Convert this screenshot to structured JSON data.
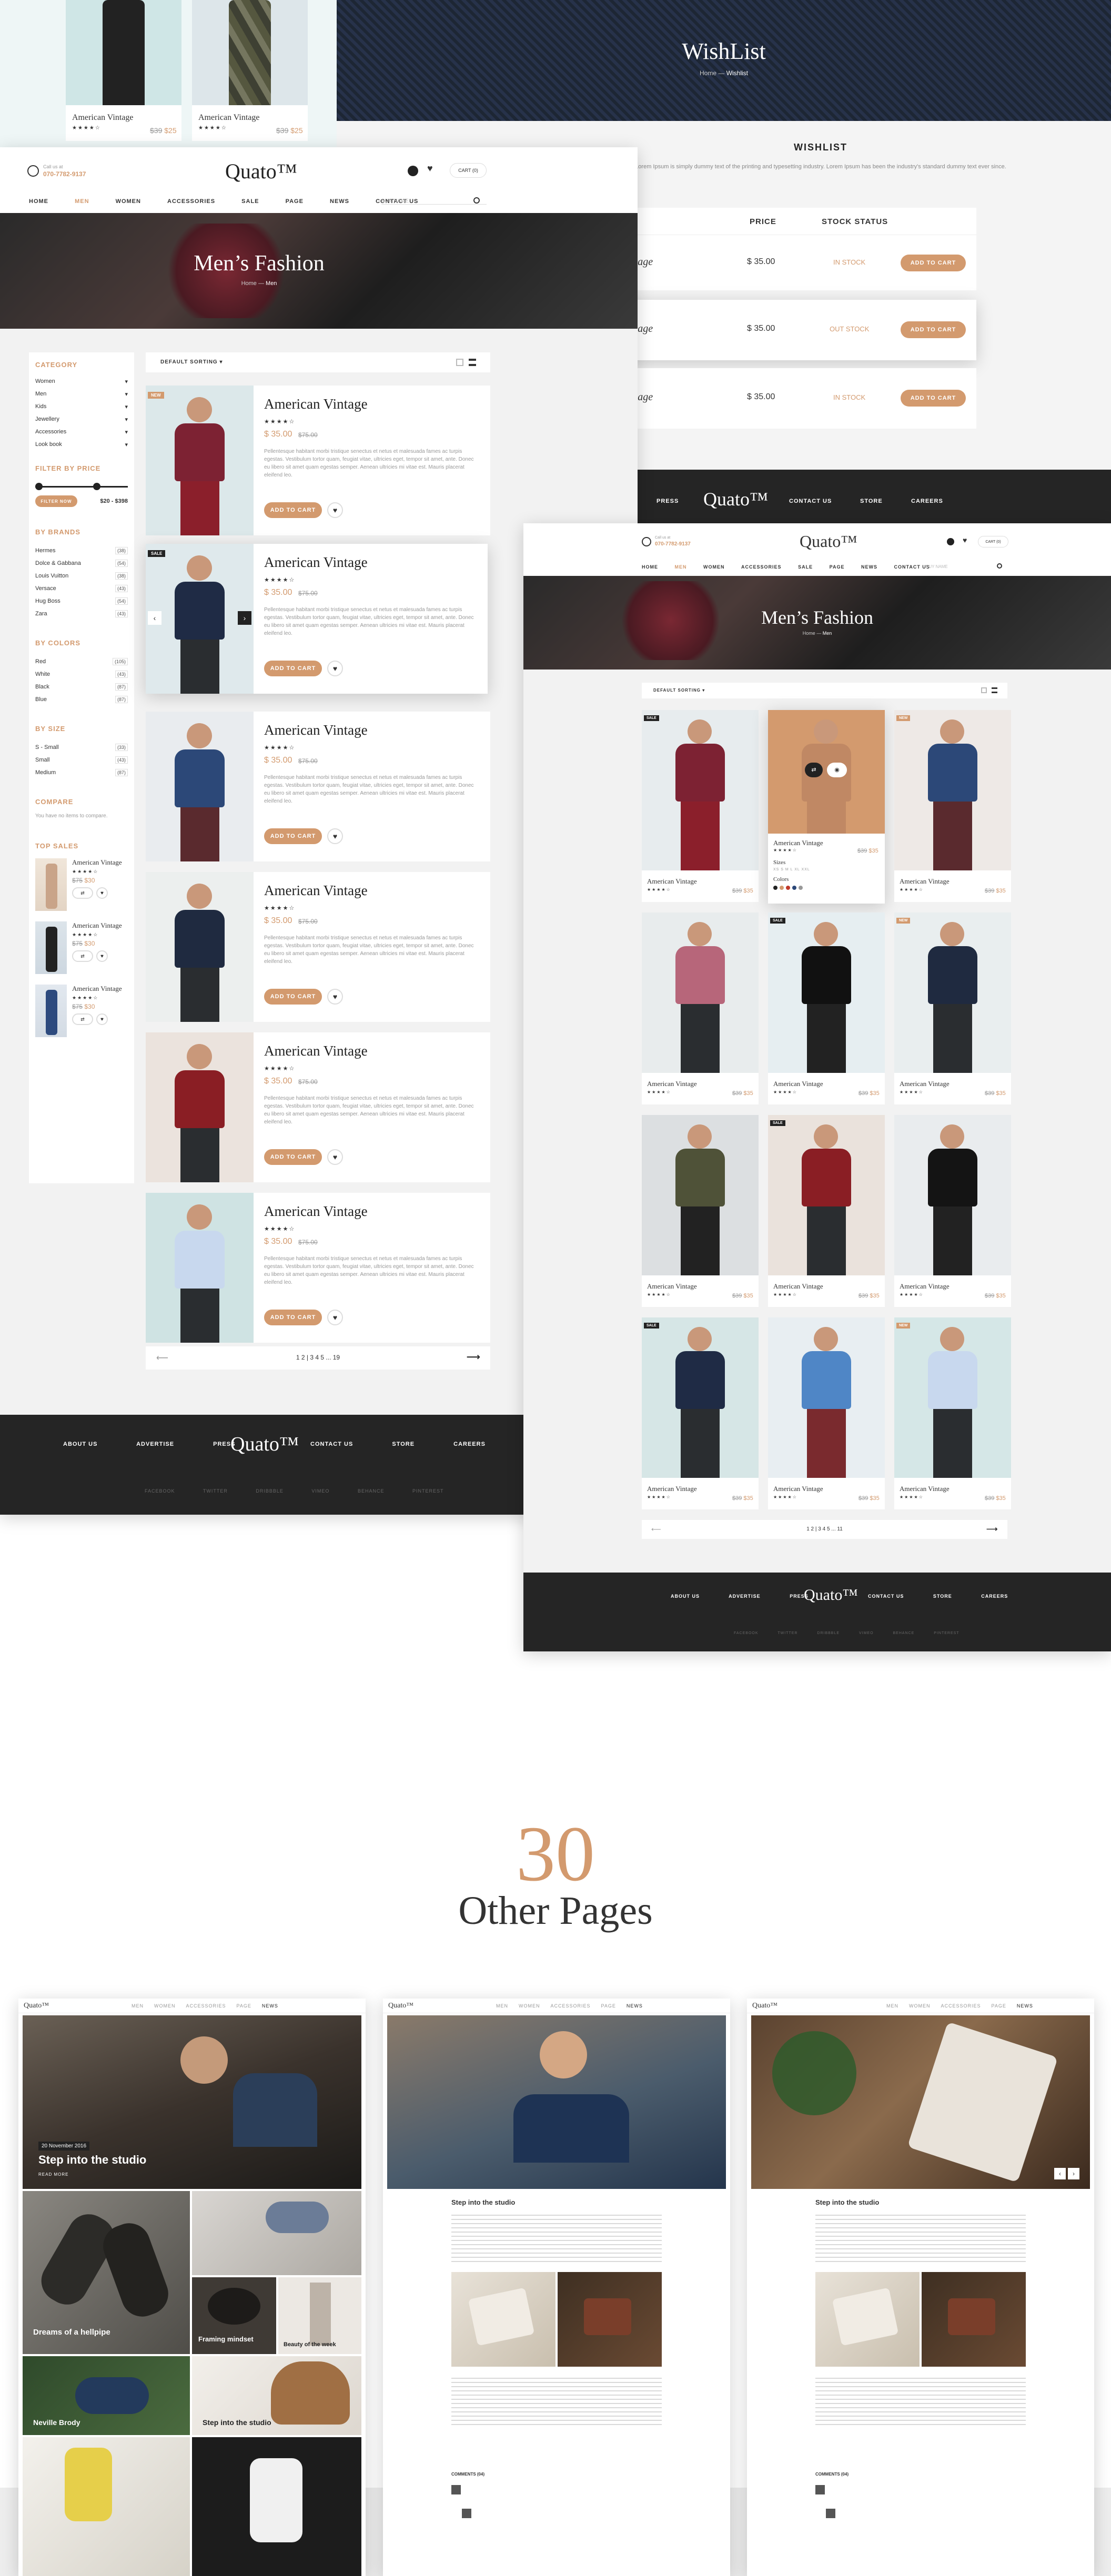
{
  "brand": "Quato™",
  "colors": {
    "accent": "#d39a6e",
    "dark": "#252525"
  },
  "top_strip": {
    "items": [
      {
        "name": "American Vintage",
        "old": "$39",
        "price": "$25"
      },
      {
        "name": "American Vintage",
        "old": "$39",
        "price": "$25"
      }
    ]
  },
  "wishlist_page": {
    "hero_title": "WishList",
    "breadcrumb": [
      "Home",
      "Wishlist"
    ],
    "heading": "WISHLIST",
    "intro": "Lorem Ipsum is simply dummy text of the printing and typesetting industry. Lorem Ipsum has been the industry's standard dummy text ever since.",
    "columns": [
      "PRICE",
      "STOCK STATUS"
    ],
    "rows": [
      {
        "name": "Page",
        "price": "$ 35.00",
        "status": "IN STOCK",
        "button": "ADD TO CART"
      },
      {
        "name": "Page",
        "price": "$ 35.00",
        "status": "OUT STOCK",
        "button": "ADD TO CART"
      },
      {
        "name": "Page",
        "price": "$ 35.00",
        "status": "IN STOCK",
        "button": "ADD TO CART"
      }
    ],
    "footer_links": [
      "PRESS",
      "CONTACT US",
      "STORE",
      "CAREERS"
    ]
  },
  "header": {
    "call_label": "Call us at",
    "phone": "070-7782-9137",
    "cart": "CART (0)",
    "nav": [
      "HOME",
      "MEN",
      "WOMEN",
      "ACCESSORIES",
      "SALE",
      "PAGE",
      "NEWS",
      "CONTACT US"
    ],
    "search_placeholder": "BUY NAME"
  },
  "list_page": {
    "hero_title": "Men’s Fashion",
    "breadcrumb": [
      "Home",
      "Men"
    ],
    "sort_label": "DEFAULT SORTING",
    "sidebar": {
      "category_title": "CATEGORY",
      "categories": [
        "Women",
        "Men",
        "Kids",
        "Jewellery",
        "Accessories",
        "Look book"
      ],
      "filter_title": "FILTER BY PRICE",
      "filter_button": "FILTER NOW",
      "price_range": "$20 - $398",
      "brands_title": "BY BRANDS",
      "brands": [
        {
          "label": "Hermes",
          "count": "(38)"
        },
        {
          "label": "Dolce & Gabbana",
          "count": "(54)"
        },
        {
          "label": "Louis Vuitton",
          "count": "(38)"
        },
        {
          "label": "Versace",
          "count": "(43)"
        },
        {
          "label": "Hug Boss",
          "count": "(54)"
        },
        {
          "label": "Zara",
          "count": "(43)"
        }
      ],
      "colors_title": "BY COLORS",
      "color_list": [
        {
          "label": "Red",
          "count": "(105)"
        },
        {
          "label": "White",
          "count": "(43)"
        },
        {
          "label": "Black",
          "count": "(87)"
        },
        {
          "label": "Blue",
          "count": "(87)"
        }
      ],
      "size_title": "BY SIZE",
      "sizes": [
        {
          "label": "S - Small",
          "count": "(33)"
        },
        {
          "label": "Small",
          "count": "(43)"
        },
        {
          "label": "Medium",
          "count": "(87)"
        }
      ],
      "compare_title": "COMPARE",
      "compare_text": "You have no items to compare.",
      "top_title": "TOP SALES",
      "top_items": [
        {
          "name": "American Vintage",
          "old": "$75",
          "price": "$30"
        },
        {
          "name": "American Vintage",
          "old": "$75",
          "price": "$30"
        },
        {
          "name": "American Vintage",
          "old": "$75",
          "price": "$30"
        }
      ]
    },
    "products": [
      {
        "name": "American Vintage",
        "price": "$ 35.00",
        "old": "$75.00",
        "badge": "NEW",
        "button": "ADD TO CART"
      },
      {
        "name": "American Vintage",
        "price": "$ 35.00",
        "old": "$75.00",
        "badge": "SALE",
        "button": "ADD TO CART"
      },
      {
        "name": "American Vintage",
        "price": "$ 35.00",
        "old": "$75.00",
        "badge": "",
        "button": "ADD TO CART"
      },
      {
        "name": "American Vintage",
        "price": "$ 35.00",
        "old": "$75.00",
        "badge": "",
        "button": "ADD TO CART"
      },
      {
        "name": "American Vintage",
        "price": "$ 35.00",
        "old": "$75.00",
        "badge": "",
        "button": "ADD TO CART"
      },
      {
        "name": "American Vintage",
        "price": "$ 35.00",
        "old": "$75.00",
        "badge": "",
        "button": "ADD TO CART"
      }
    ],
    "description": "Pellentesque habitant morbi tristique senectus et netus et malesuada fames ac turpis egestas. Vestibulum tortor quam, feugiat vitae, ultricies eget, tempor sit amet, ante. Donec eu libero sit amet quam egestas semper. Aenean ultricies mi vitae est. Mauris placerat eleifend leo.",
    "pagination": "1 2 | 3 4 5 ... 19",
    "footer_links": [
      "ABOUT US",
      "ADVERTISE",
      "PRESS",
      "CONTACT US",
      "STORE",
      "CAREERS"
    ],
    "social": [
      "FACEBOOK",
      "TWITTER",
      "DRIBBBLE",
      "VIMEO",
      "BEHANCE",
      "PINTEREST"
    ]
  },
  "grid_page": {
    "hero_title": "Men’s Fashion",
    "breadcrumb": [
      "Home",
      "Men"
    ],
    "sort_label": "DEFAULT SORTING",
    "item_name": "American Vintage",
    "item_old": "$39",
    "item_price": "$35",
    "hover_sizes_label": "Sizes",
    "hover_sizes": "XS S M L XL XXL",
    "hover_colors_label": "Colors",
    "pagination": "1 2 | 3 4 5 ... 11"
  },
  "other_pages": {
    "number": "30",
    "label": "Other Pages"
  },
  "news_preview": {
    "date": "20 November 2016",
    "title": "Step into the studio",
    "tiles": [
      "Dreams of a hellpipe",
      "Framing mindset",
      "Beauty of the week",
      "Neville Brody",
      "Step into the studio"
    ],
    "read_more": "READ MORE",
    "article_title": "Step into the studio",
    "comments": "COMMENTS (04)"
  }
}
